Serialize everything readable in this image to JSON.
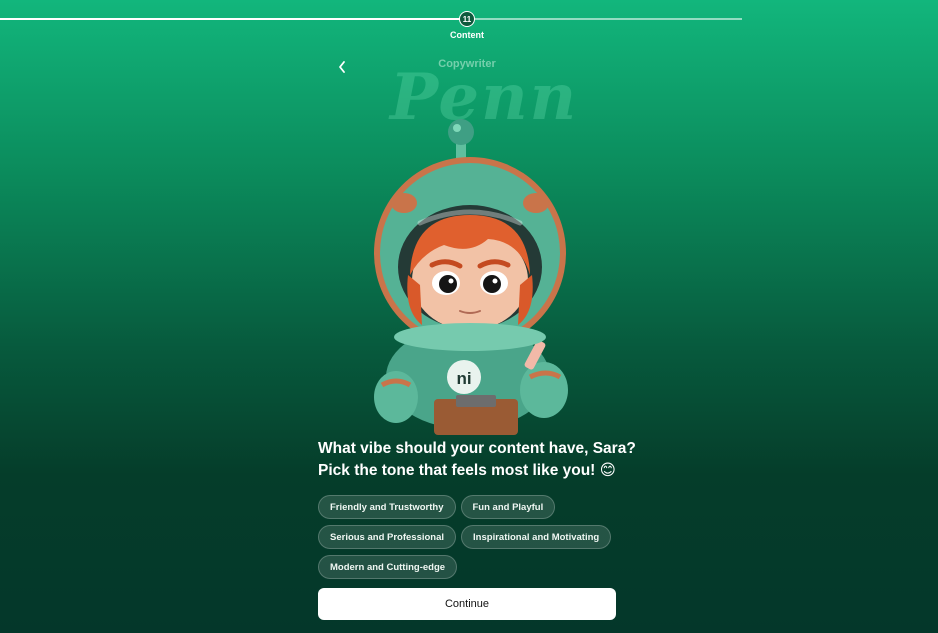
{
  "progress": {
    "step": "11",
    "label": "Content",
    "fraction": 0.63
  },
  "header": {
    "role": "Copywriter",
    "name": "Penn",
    "back_icon": "chevron-left-icon"
  },
  "question": {
    "line1": "What vibe should your content have, Sara?",
    "line2": "Pick the tone that feels most like you!",
    "emoji": "😊"
  },
  "options": [
    "Friendly and Trustworthy",
    "Fun and Playful",
    "Serious and Professional",
    "Inspirational and Motivating",
    "Modern and Cutting-edge"
  ],
  "continue_label": "Continue",
  "colors": {
    "accent": "#12b67c",
    "dark": "#04372a",
    "button": "#ffffff"
  }
}
